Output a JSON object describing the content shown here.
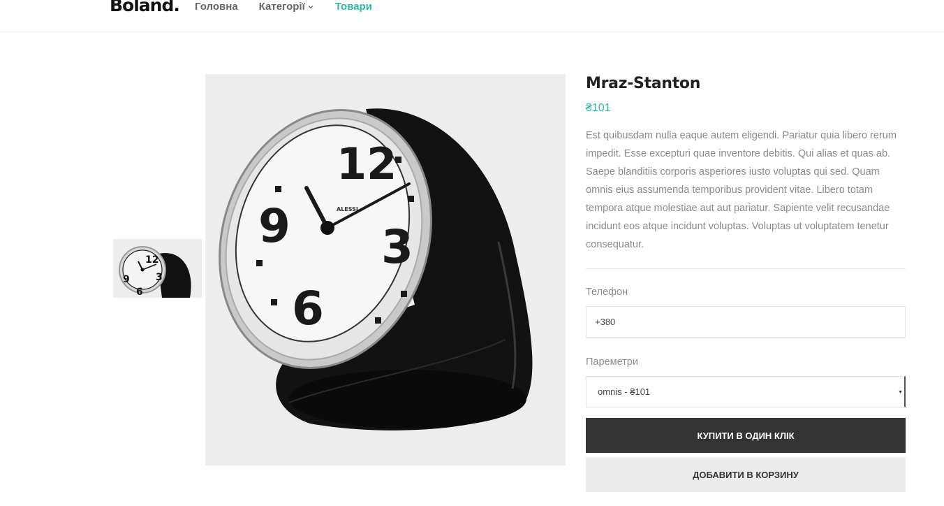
{
  "header": {
    "logo": "Boland.",
    "nav": [
      {
        "label": "Головна"
      },
      {
        "label": "Категорії"
      },
      {
        "label": "Товари"
      }
    ]
  },
  "product": {
    "title": "Mraz-Stanton",
    "price": "₴101",
    "description": "Est quibusdam nulla eaque autem eligendi. Pariatur quia libero rerum impedit. Esse excepturi quae inventore debitis. Qui alias et quas ab. Saepe blanditiis corporis asperiores iusto voluptas qui sed. Quam omnis eius assumenda temporibus provident vitae. Libero totam tempora atque molestiae aut aut pariatur. Sapiente velit recusandae incidunt eos atque incidunt voluptas. Voluptas ut voluptatem tenetur consequatur.",
    "clock_brand": "ALESSI",
    "clock_numbers": [
      "12",
      "3",
      "6",
      "9"
    ]
  },
  "form": {
    "phone_label": "Телефон",
    "phone_value": "+380",
    "params_label": "Пареметри",
    "params_value": "omnis - ₴101",
    "buy_button": "КУПИТИ В ОДИН КЛІК",
    "cart_button": "ДОБАВИТИ В КОРЗИНУ"
  },
  "colors": {
    "accent": "#2bb8aa",
    "dark_button": "#333333",
    "light_button": "#ececec",
    "image_bg": "#ededed"
  }
}
